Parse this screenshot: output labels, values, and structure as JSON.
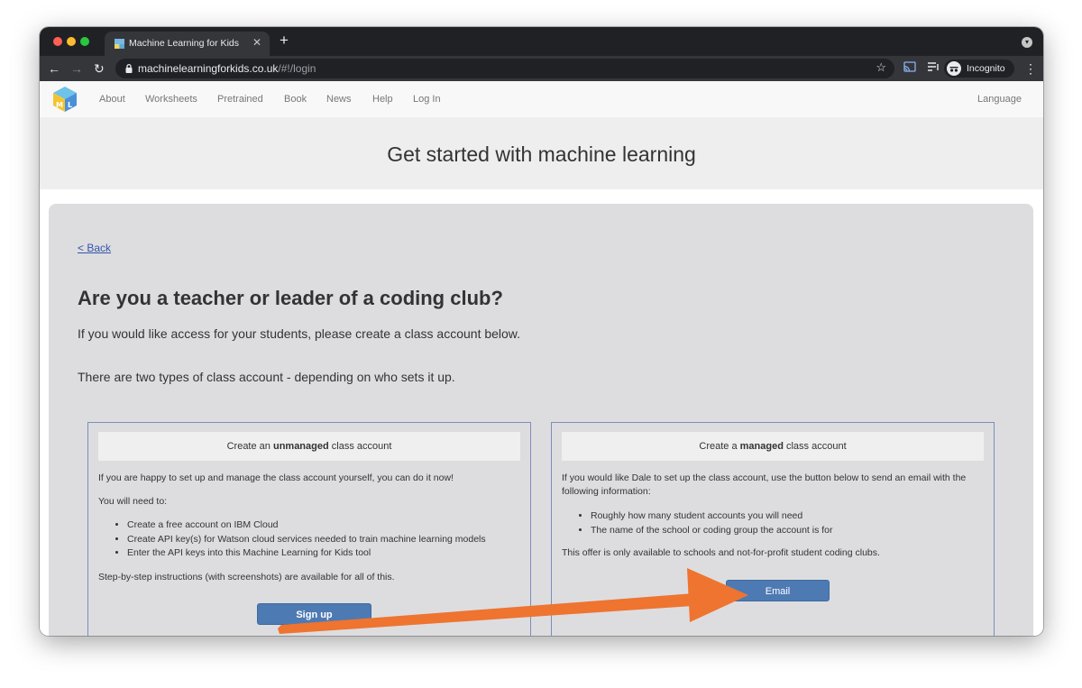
{
  "browser": {
    "tab_title": "Machine Learning for Kids",
    "tab_close": "✕",
    "new_tab": "+",
    "url_domain": "machinelearningforkids.co.uk",
    "url_path": "/#!/login",
    "profile_label": "Incognito",
    "icons": [
      "back-arrow-icon",
      "forward-arrow-icon",
      "reload-icon",
      "lock-icon",
      "star-icon",
      "cast-icon",
      "media-queue-icon",
      "incognito-icon",
      "kebab-menu-icon"
    ]
  },
  "nav": {
    "items": [
      "About",
      "Worksheets",
      "Pretrained",
      "Book",
      "News",
      "Help",
      "Log In"
    ],
    "language": "Language"
  },
  "hero": {
    "title": "Get started with machine learning"
  },
  "main": {
    "back": "< Back",
    "heading": "Are you a teacher or leader of a coding club?",
    "intro": "If you would like access for your students, please create a class account below.",
    "types": "There are two types of class account - depending on who sets it up."
  },
  "unmanaged": {
    "title_pre": "Create an ",
    "title_bold": "unmanaged",
    "title_post": " class account",
    "p1": "If you are happy to set up and manage the class account yourself, you can do it now!",
    "p2": "You will need to:",
    "items": [
      "Create a free account on IBM Cloud",
      "Create API key(s) for Watson cloud services needed to train machine learning models",
      "Enter the API keys into this Machine Learning for Kids tool"
    ],
    "p3": "Step-by-step instructions (with screenshots) are available for all of this.",
    "button": "Sign up"
  },
  "managed": {
    "title_pre": "Create a ",
    "title_bold": "managed",
    "title_post": " class account",
    "p1": "If you would like Dale to set up the class account, use the button below to send an email with the following information:",
    "items": [
      "Roughly how many student accounts you will need",
      "The name of the school or coding group the account is for"
    ],
    "p2": "This offer is only available to schools and not-for-profit student coding clubs.",
    "button": "Email"
  },
  "colors": {
    "accent_button": "#4e7ab3",
    "annotation_arrow": "#ee7430",
    "panel_bg": "#dddde0",
    "link": "#3355aa"
  }
}
